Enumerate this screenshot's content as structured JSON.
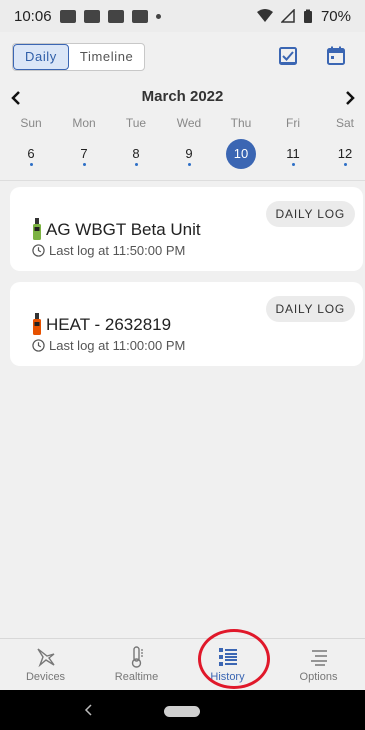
{
  "status_bar": {
    "time": "10:06",
    "battery": "70%"
  },
  "header": {
    "tabs": [
      {
        "label": "Daily",
        "active": true
      },
      {
        "label": "Timeline",
        "active": false
      }
    ],
    "icons": [
      "checklist-icon",
      "calendar-icon"
    ]
  },
  "calendar": {
    "month_label": "March 2022",
    "days": [
      "Sun",
      "Mon",
      "Tue",
      "Wed",
      "Thu",
      "Fri",
      "Sat"
    ],
    "dates": [
      "6",
      "7",
      "8",
      "9",
      "10",
      "11",
      "12"
    ],
    "selected_date": "10",
    "accent": "#3b66b3"
  },
  "cards": [
    {
      "title": "AG WBGT Beta Unit",
      "subtitle": "Last log at 11:50:00 PM",
      "chip": "DAILY LOG",
      "device_color": "#7cb342"
    },
    {
      "title": "HEAT - 2632819",
      "subtitle": "Last log at 11:00:00 PM",
      "chip": "DAILY LOG",
      "device_color": "#e65100"
    }
  ],
  "bottom_nav": {
    "items": [
      {
        "label": "Devices",
        "icon": "devices-icon"
      },
      {
        "label": "Realtime",
        "icon": "thermometer-icon"
      },
      {
        "label": "History",
        "icon": "history-list-icon",
        "active": true
      },
      {
        "label": "Options",
        "icon": "options-menu-icon"
      }
    ],
    "highlight_color": "#e0182a"
  }
}
